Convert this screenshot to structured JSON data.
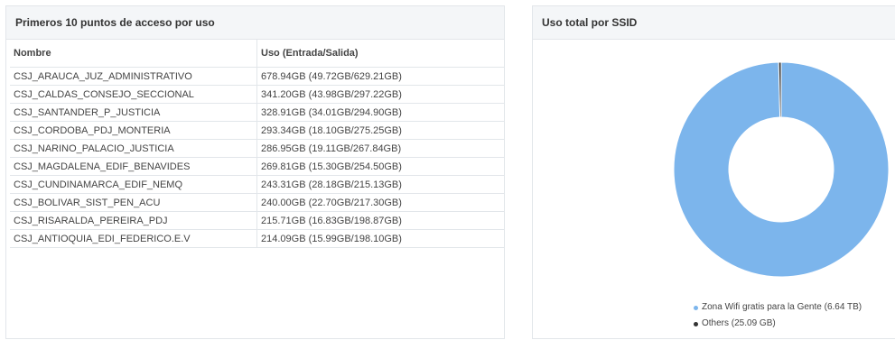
{
  "left_panel": {
    "title": "Primeros 10 puntos de acceso por uso",
    "columns": [
      "Nombre",
      "Uso (Entrada/Salida)"
    ],
    "rows": [
      {
        "name": "CSJ_ARAUCA_JUZ_ADMINISTRATIVO",
        "usage": "678.94GB (49.72GB/629.21GB)"
      },
      {
        "name": "CSJ_CALDAS_CONSEJO_SECCIONAL",
        "usage": "341.20GB (43.98GB/297.22GB)"
      },
      {
        "name": "CSJ_SANTANDER_P_JUSTICIA",
        "usage": "328.91GB (34.01GB/294.90GB)"
      },
      {
        "name": "CSJ_CORDOBA_PDJ_MONTERIA",
        "usage": "293.34GB (18.10GB/275.25GB)"
      },
      {
        "name": "CSJ_NARINO_PALACIO_JUSTICIA",
        "usage": "286.95GB (19.11GB/267.84GB)"
      },
      {
        "name": "CSJ_MAGDALENA_EDIF_BENAVIDES",
        "usage": "269.81GB (15.30GB/254.50GB)"
      },
      {
        "name": "CSJ_CUNDINAMARCA_EDIF_NEMQ",
        "usage": "243.31GB (28.18GB/215.13GB)"
      },
      {
        "name": "CSJ_BOLIVAR_SIST_PEN_ACU",
        "usage": "240.00GB (22.70GB/217.30GB)"
      },
      {
        "name": "CSJ_RISARALDA_PEREIRA_PDJ",
        "usage": "215.71GB (16.83GB/198.87GB)"
      },
      {
        "name": "CSJ_ANTIOQUIA_EDI_FEDERICO.E.V",
        "usage": "214.09GB (15.99GB/198.10GB)"
      }
    ]
  },
  "right_panel": {
    "title": "Uso total por SSID"
  },
  "chart_data": {
    "type": "pie",
    "donut": true,
    "title": "Uso total por SSID",
    "series": [
      {
        "name": "Zona Wifi gratis para la Gente (6.64 TB)",
        "value_tb": 6.64,
        "color": "#7cb5ec"
      },
      {
        "name": "Others (25.09 GB)",
        "value_tb": 0.02509,
        "color": "#333333"
      }
    ],
    "legend_position": "bottom"
  }
}
